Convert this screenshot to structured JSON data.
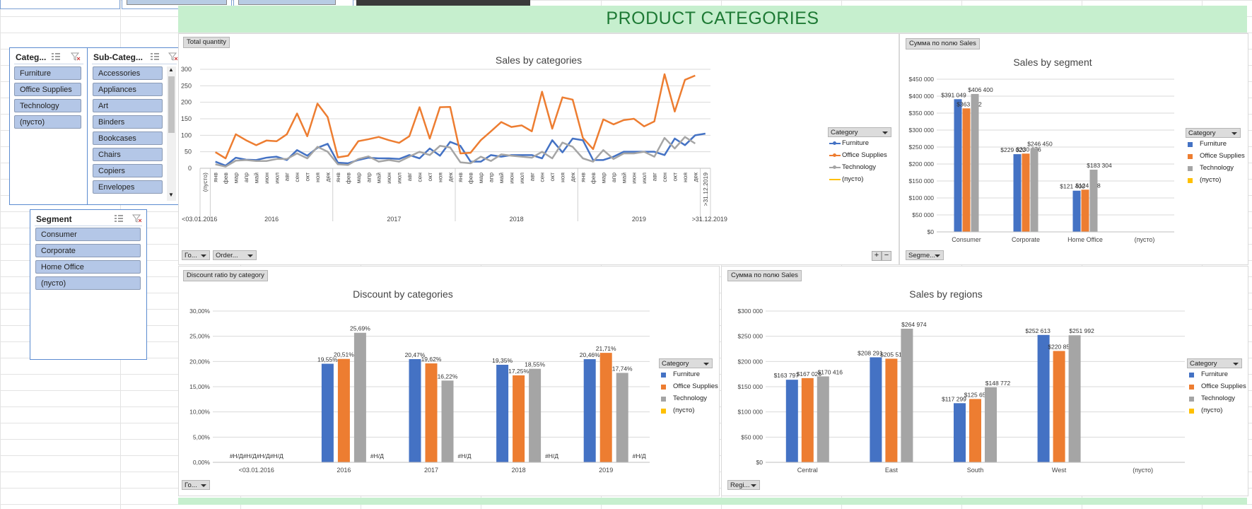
{
  "page": {
    "title": "PRODUCT CATEGORIES",
    "colors": {
      "title_band": "#c6efce",
      "title_text": "#1e7a35",
      "furniture": "#4472c4",
      "office": "#ed7d31",
      "technology": "#a5a5a5",
      "empty": "#ffc000"
    }
  },
  "slicers": {
    "category": {
      "title": "Categ...",
      "items": [
        "Furniture",
        "Office Supplies",
        "Technology",
        "(пусто)"
      ],
      "icons": [
        "multi-select-icon",
        "clear-filter-icon"
      ]
    },
    "subcategory": {
      "title": "Sub-Categ...",
      "items": [
        "Accessories",
        "Appliances",
        "Art",
        "Binders",
        "Bookcases",
        "Chairs",
        "Copiers",
        "Envelopes"
      ]
    },
    "segment": {
      "title": "Segment",
      "items": [
        "Consumer",
        "Corporate",
        "Home Office",
        "(пусто)"
      ]
    }
  },
  "charts": {
    "sales_by_categories": {
      "field_button": "Total quantity",
      "buttons": [
        "Го...",
        "Order..."
      ],
      "legend_title": "Category",
      "legend": [
        "Furniture",
        "Office Supplies",
        "Technology",
        "(пусто)"
      ],
      "plus": "+",
      "minus": "−"
    },
    "sales_by_segment": {
      "field_button": "Сумма по полю Sales",
      "buttons": [
        "Segme..."
      ],
      "legend_title": "Category",
      "legend": [
        "Furniture",
        "Office Supplies",
        "Technology",
        "(пусто)"
      ]
    },
    "discount_by_categories": {
      "field_button": "Discount ratio  by category",
      "buttons": [
        "Го..."
      ],
      "legend_title": "Category",
      "legend": [
        "Furniture",
        "Office Supplies",
        "Technology",
        "(пусто)"
      ]
    },
    "sales_by_regions": {
      "field_button": "Сумма по полю Sales",
      "buttons": [
        "Regi..."
      ],
      "legend_title": "Category",
      "legend": [
        "Furniture",
        "Office Supplies",
        "Technology",
        "(пусто)"
      ]
    }
  },
  "chart_data": [
    {
      "type": "line",
      "title": "Sales by categories",
      "ylim": [
        0,
        300
      ],
      "yticks": [
        "0",
        "50",
        "100",
        "150",
        "200",
        "250",
        "300"
      ],
      "x_first": "(пусто)",
      "months": [
        "янв",
        "фев",
        "мар",
        "апр",
        "май",
        "июн",
        "июл",
        "авг",
        "сен",
        "окт",
        "ноя",
        "дек"
      ],
      "x_last": ">31.12.2019",
      "year_labels": [
        "<03.01.2016",
        "2016",
        "2017",
        "2018",
        "2019",
        ">31.12.2019"
      ],
      "series": [
        {
          "name": "Furniture",
          "values": [
            20,
            8,
            32,
            26,
            25,
            32,
            35,
            25,
            55,
            38,
            62,
            74,
            17,
            15,
            25,
            32,
            30,
            30,
            28,
            40,
            30,
            60,
            38,
            80,
            68,
            20,
            20,
            40,
            35,
            40,
            40,
            40,
            30,
            85,
            48,
            90,
            85,
            25,
            25,
            35,
            50,
            50,
            50,
            50,
            40,
            90,
            70,
            100,
            105
          ]
        },
        {
          "name": "Office Supplies",
          "values": [
            49,
            30,
            103,
            85,
            70,
            84,
            82,
            103,
            166,
            97,
            196,
            155,
            33,
            38,
            82,
            88,
            95,
            85,
            77,
            97,
            185,
            90,
            185,
            186,
            45,
            47,
            85,
            112,
            140,
            125,
            130,
            112,
            232,
            120,
            215,
            208,
            92,
            58,
            148,
            133,
            146,
            150,
            127,
            142,
            285,
            172,
            268,
            281
          ]
        },
        {
          "name": "Technology",
          "values": [
            12,
            5,
            23,
            25,
            22,
            22,
            28,
            28,
            45,
            30,
            65,
            50,
            12,
            10,
            28,
            36,
            20,
            25,
            20,
            35,
            50,
            40,
            68,
            63,
            18,
            15,
            35,
            22,
            42,
            38,
            35,
            32,
            50,
            30,
            78,
            65,
            30,
            20,
            55,
            28,
            45,
            45,
            50,
            35,
            92,
            60,
            95,
            75
          ]
        },
        {
          "name": "(пусто)",
          "values": []
        }
      ]
    },
    {
      "type": "bar",
      "title": "Sales by segment",
      "categories": [
        "Consumer",
        "Corporate",
        "Home Office",
        "(пусто)"
      ],
      "ylim": [
        0,
        450000
      ],
      "yticks": [
        "$0",
        "$50 000",
        "$100 000",
        "$150 000",
        "$200 000",
        "$250 000",
        "$300 000",
        "$350 000",
        "$400 000",
        "$450 000"
      ],
      "series": [
        {
          "name": "Furniture",
          "values": [
            391049,
            229020,
            121400,
            null
          ],
          "labels": [
            "$391 049",
            "$229 020",
            "$121 400",
            ""
          ]
        },
        {
          "name": "Office Supplies",
          "values": [
            363952,
            230676,
            124418,
            null
          ],
          "labels": [
            "$363 952",
            "$230 676",
            "$124 418",
            ""
          ]
        },
        {
          "name": "Technology",
          "values": [
            406400,
            246450,
            183304,
            null
          ],
          "labels": [
            "$406 400",
            "$246 450",
            "$183 304",
            ""
          ]
        }
      ]
    },
    {
      "type": "bar",
      "title": "Discount by categories",
      "categories": [
        "<03.01.2016",
        "2016",
        "2017",
        "2018",
        "2019"
      ],
      "ylim": [
        0,
        30
      ],
      "yticks": [
        "0,00%",
        "5,00%",
        "10,00%",
        "15,00%",
        "20,00%",
        "25,00%",
        "30,00%"
      ],
      "na_labels": [
        "#Н/Д#Н/Д#Н/Д#Н/Д",
        "#Н/Д",
        "#Н/Д",
        "#Н/Д",
        "#Н/Д"
      ],
      "series": [
        {
          "name": "Furniture",
          "values": [
            null,
            19.55,
            20.47,
            19.35,
            20.46
          ],
          "labels": [
            "",
            "19,55%",
            "20,47%",
            "19,35%",
            "20,46%"
          ]
        },
        {
          "name": "Office Supplies",
          "values": [
            null,
            20.51,
            19.62,
            17.25,
            21.71
          ],
          "labels": [
            "",
            "20,51%",
            "19,62%",
            "17,25%",
            "21,71%"
          ]
        },
        {
          "name": "Technology",
          "values": [
            null,
            25.69,
            16.22,
            18.55,
            17.74
          ],
          "labels": [
            "",
            "25,69%",
            "16,22%",
            "18,55%",
            "17,74%"
          ]
        }
      ]
    },
    {
      "type": "bar",
      "title": "Sales by regions",
      "categories": [
        "Central",
        "East",
        "South",
        "West",
        "(пусто)"
      ],
      "ylim": [
        0,
        300000
      ],
      "yticks": [
        "$0",
        "$50 000",
        "$100 000",
        "$150 000",
        "$200 000",
        "$250 000",
        "$300 000"
      ],
      "series": [
        {
          "name": "Furniture",
          "values": [
            163797,
            208291,
            117299,
            252613,
            null
          ],
          "labels": [
            "$163 797",
            "$208 291",
            "$117 299",
            "$252 613",
            ""
          ]
        },
        {
          "name": "Office Supplies",
          "values": [
            167026,
            205516,
            125651,
            220853,
            null
          ],
          "labels": [
            "$167 026",
            "$205 516",
            "$125 651",
            "$220 853",
            ""
          ]
        },
        {
          "name": "Technology",
          "values": [
            170416,
            264974,
            148772,
            251992,
            null
          ],
          "labels": [
            "$170 416",
            "$264 974",
            "$148 772",
            "$251 992",
            ""
          ]
        }
      ]
    }
  ]
}
